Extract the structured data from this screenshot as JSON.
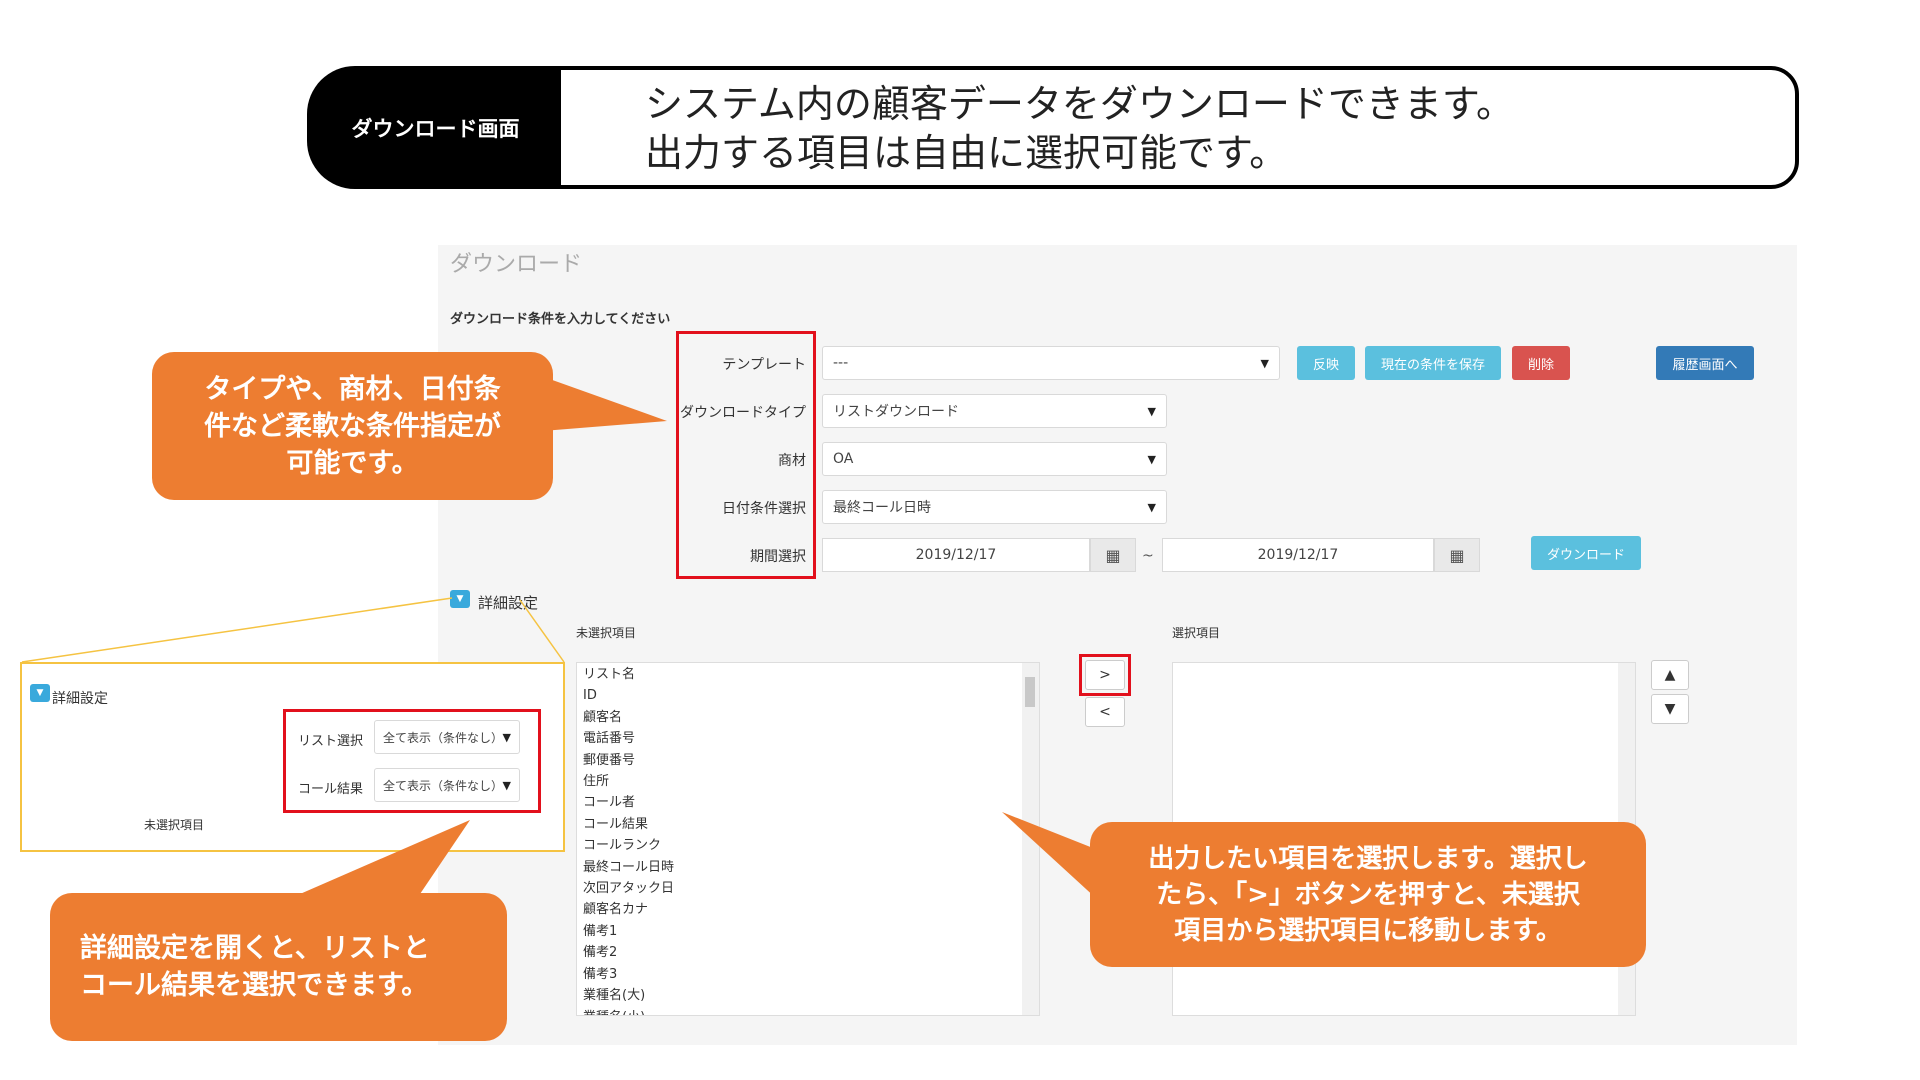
{
  "header": {
    "badge": "ダウンロード画面",
    "line1": "システム内の顧客データをダウンロードできます。",
    "line2": "出力する項目は自由に選択可能です。"
  },
  "screen": {
    "page_title": "ダウンロード",
    "instruction": "ダウンロード条件を入力してください",
    "fields": {
      "template_label": "テンプレート",
      "template_value": "---",
      "type_label": "ダウンロードタイプ",
      "type_value": "リストダウンロード",
      "product_label": "商材",
      "product_value": "OA",
      "date_cond_label": "日付条件選択",
      "date_cond_value": "最終コール日時",
      "period_label": "期間選択",
      "date_from": "2019/12/17",
      "tilde": "~",
      "date_to": "2019/12/17"
    },
    "buttons": {
      "apply": "反映",
      "save": "現在の条件を保存",
      "delete": "削除",
      "history": "履歴画面へ",
      "download": "ダウンロード",
      "move_right": ">",
      "move_left": "<",
      "up": "⌃",
      "down": "⌄"
    },
    "detail_toggle": "詳細設定",
    "unselected_header": "未選択項目",
    "selected_header": "選択項目",
    "unselected_items": [
      "リスト名",
      "ID",
      "顧客名",
      "電話番号",
      "郵便番号",
      "住所",
      "コール者",
      "コール結果",
      "コールランク",
      "最終コール日時",
      "次回アタック日",
      "顧客名カナ",
      "備考1",
      "備考2",
      "備考3",
      "業種名(大)",
      "業種名(小)"
    ]
  },
  "inset": {
    "toggle_label": "詳細設定",
    "list_select_label": "リスト選択",
    "list_select_value": "全て表示（条件なし）",
    "call_result_label": "コール結果",
    "call_result_value": "全て表示（条件なし）",
    "unselected_label": "未選択項目"
  },
  "callouts": {
    "filters": [
      "タイプや、商材、日付条",
      "件など柔軟な条件指定が",
      "可能です。"
    ],
    "detail": [
      "詳細設定を開くと、リストと",
      "コール結果を選択できます。"
    ],
    "select": [
      "出力したい項目を選択します。選択し",
      "たら、「>」ボタンを押すと、未選択",
      "項目から選択項目に移動します。"
    ]
  },
  "colors": {
    "callout": "#ed7d31",
    "highlight": "#e2101c",
    "button_cyan": "#5bc0de",
    "button_red": "#d9534f",
    "button_blue": "#337ab7",
    "inset_border": "#f5c342"
  }
}
